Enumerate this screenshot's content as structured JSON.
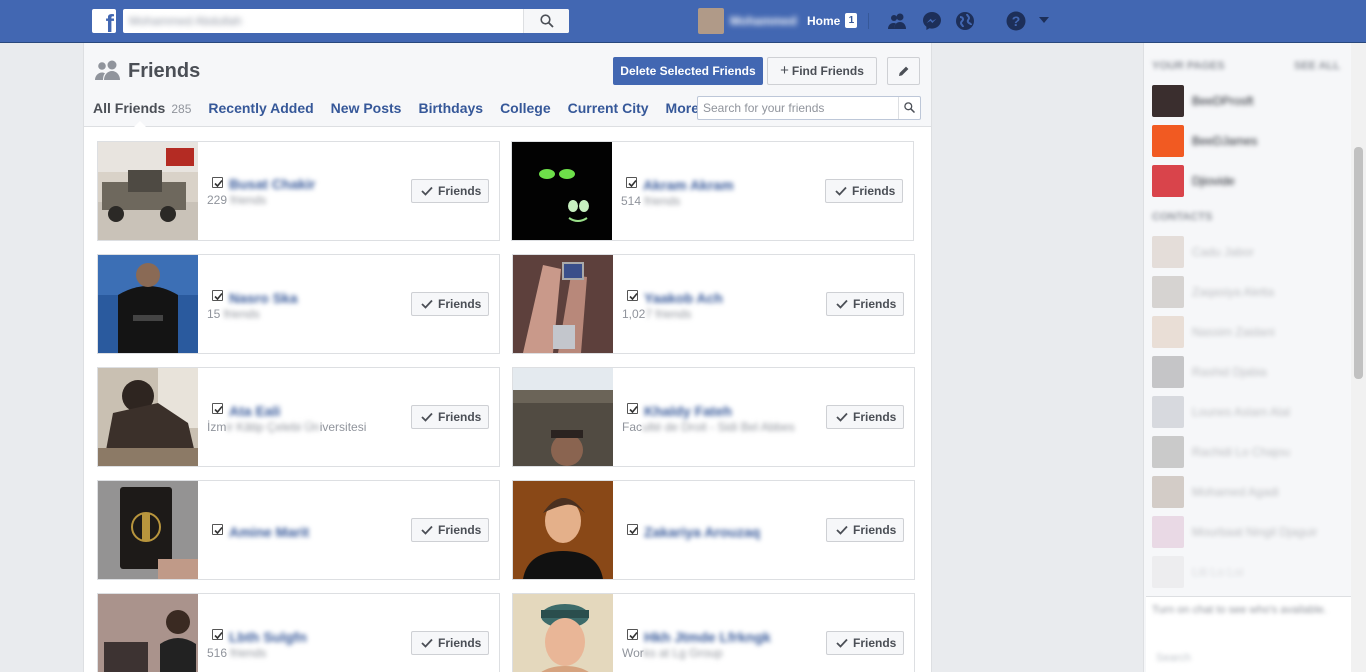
{
  "topbar": {
    "search_value": "Mohammed Abdullah",
    "profile_name": "Mohammed",
    "home_label": "Home",
    "home_badge": "1",
    "colors": {
      "brand": "#4267b2",
      "brand_dark": "#29487d"
    }
  },
  "page": {
    "title": "Friends",
    "delete_button": "Delete Selected Friends",
    "find_button": "Find Friends",
    "find_button_prefix": "+",
    "tabs": [
      {
        "label": "All Friends",
        "count": "285"
      },
      {
        "label": "Recently Added"
      },
      {
        "label": "New Posts"
      },
      {
        "label": "Birthdays"
      },
      {
        "label": "College"
      },
      {
        "label": "Current City"
      },
      {
        "label": "More"
      }
    ],
    "search_placeholder": "Search for your friends"
  },
  "friends": [
    {
      "name": "Busat Chakir",
      "meta_visible": "229 ",
      "meta_hidden": "friends",
      "button": "Friends",
      "checked": true
    },
    {
      "name": "Akram Akram",
      "meta_visible": "514 ",
      "meta_hidden": "friends",
      "button": "Friends",
      "checked": true
    },
    {
      "name": "Nasro Ska",
      "meta_visible": "15 ",
      "meta_hidden": "friends",
      "button": "Friends",
      "checked": true
    },
    {
      "name": "Yaakob Ach",
      "meta_visible": "1,02",
      "meta_hidden": "7 friends",
      "button": "Friends",
      "checked": true
    },
    {
      "name": "Ata Eali",
      "meta_visible": "İzm",
      "meta_hidden": "ir Kâtip Çelebi Ün",
      "meta_tail": "iversitesi",
      "button": "Friends",
      "checked": true
    },
    {
      "name": "Khaldy Fateh",
      "meta_visible": "Fac",
      "meta_hidden": "ulté de Droit - Sidi Bel Abbes",
      "button": "Friends",
      "checked": true
    },
    {
      "name": "Amine Marit",
      "meta_visible": "",
      "meta_hidden": "",
      "button": "Friends",
      "checked": true
    },
    {
      "name": "Zakariya Arouzaq",
      "meta_visible": "",
      "meta_hidden": "",
      "button": "Friends",
      "checked": true
    },
    {
      "name": "Lbth Sulgfn",
      "meta_visible": "516",
      "meta_hidden": " friends",
      "button": "Friends",
      "checked": true
    },
    {
      "name": "Hkh Jtmde Lfrkngk",
      "meta_visible": "Wor",
      "meta_hidden": "ks at Lg Group",
      "button": "Friends",
      "checked": true
    }
  ],
  "sidebar": {
    "pages_heading": "YOUR PAGES",
    "see_all": "SEE ALL",
    "pages": [
      "BeeDProsft",
      "BeeDJames",
      "Djiovide"
    ],
    "contacts_heading": "CONTACTS",
    "contacts": [
      "Cadu Jabor",
      "Zaqasiya Aletta",
      "Nassim Zaidani",
      "Rashid Djabia",
      "Lounes Aslam Alal",
      "Rachidi Lo Chajou",
      "Mohamed Agadi",
      "Mourbaat Ningil Djaguir",
      "Liti Lo Loi"
    ],
    "chat_text": "Turn on chat to see who's available.",
    "chat_search": "Search"
  }
}
